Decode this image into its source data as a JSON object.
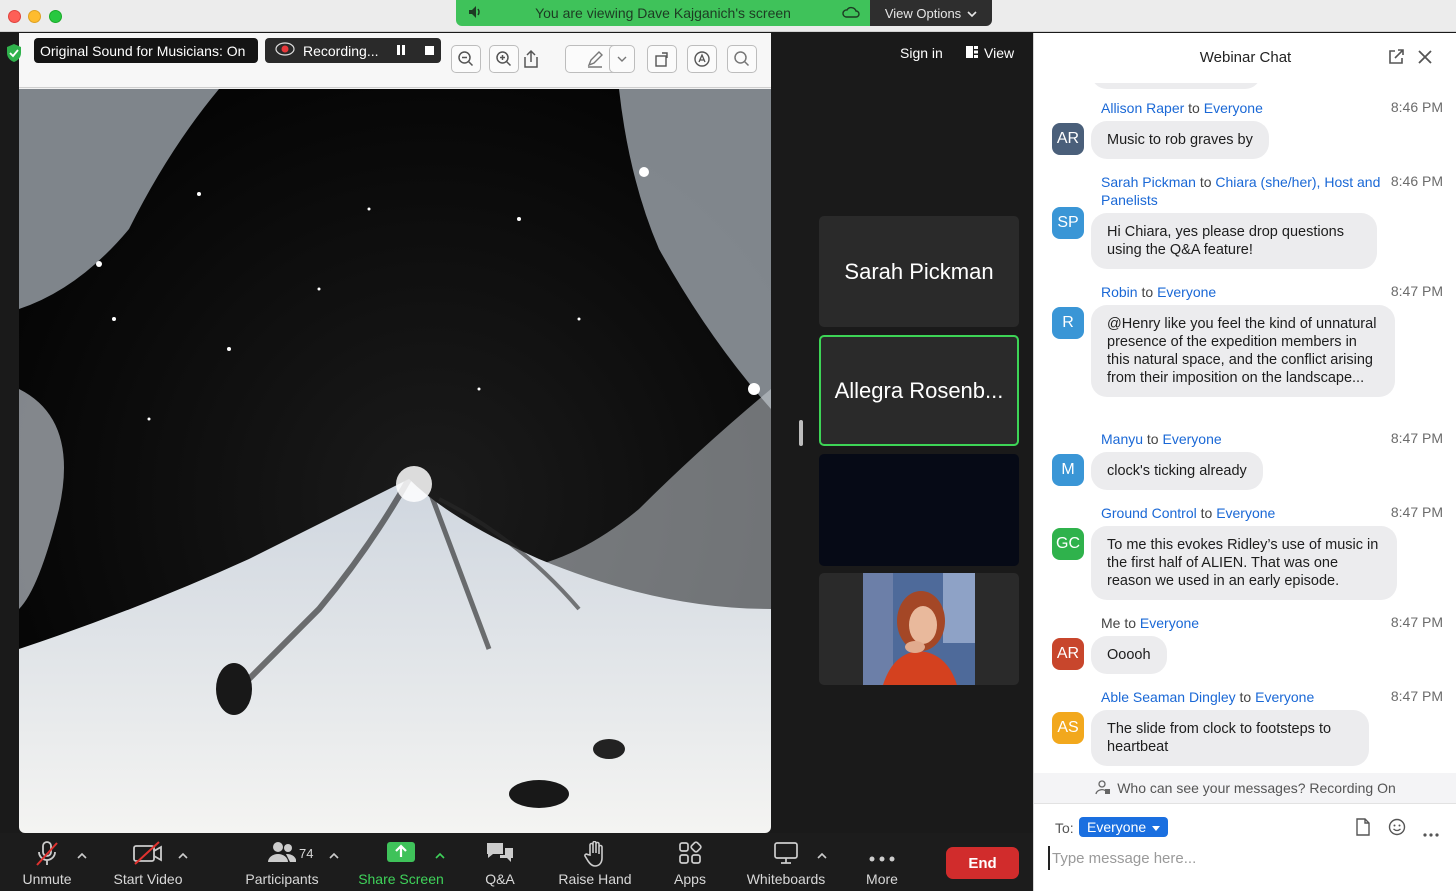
{
  "banner": {
    "text": "You are viewing Dave Kajganich's screen",
    "view_options": "View Options"
  },
  "overlay": {
    "sound": "Original Sound for Musicians: On",
    "recording": "Recording..."
  },
  "topright": {
    "sign_in": "Sign in",
    "view": "View"
  },
  "tiles": [
    {
      "name": "Sarah Pickman"
    },
    {
      "name": "Allegra Rosenb..."
    }
  ],
  "toolbar": {
    "unmute": "Unmute",
    "start_video": "Start Video",
    "participants": "Participants",
    "participants_count": "74",
    "share_screen": "Share Screen",
    "qa": "Q&A",
    "raise_hand": "Raise Hand",
    "apps": "Apps",
    "whiteboards": "Whiteboards",
    "more": "More",
    "end": "End"
  },
  "chat": {
    "title": "Webinar Chat",
    "messages": [
      {
        "sender": "Allison Raper",
        "to_word": "to",
        "recipient": "Everyone",
        "time": "8:46 PM",
        "initials": "AR",
        "avatar_color": "#4a5f7a",
        "text": "Music to rob graves by"
      },
      {
        "sender": "Sarah Pickman",
        "to_word": "to",
        "recipient": "Chiara (she/her), Host and Panelists",
        "time": "8:46 PM",
        "initials": "SP",
        "avatar_color": "#3a96d6",
        "text": "Hi Chiara, yes please drop questions using the Q&A feature!"
      },
      {
        "sender": "Robin",
        "to_word": "to",
        "recipient": "Everyone",
        "time": "8:47 PM",
        "initials": "R",
        "avatar_color": "#3a96d6",
        "text": "@Henry like you feel the kind of unnatural presence of the expedition members in this natural space, and the conflict arising from their imposition on the landscape..."
      },
      {
        "sender": "Manyu",
        "to_word": "to",
        "recipient": "Everyone",
        "time": "8:47 PM",
        "initials": "M",
        "avatar_color": "#3a96d6",
        "text": "clock's ticking already"
      },
      {
        "sender": "Ground Control",
        "to_word": "to",
        "recipient": "Everyone",
        "time": "8:47 PM",
        "initials": "GC",
        "avatar_color": "#2fb24c",
        "text": "To me this evokes Ridley’s use of music in the first half of ALIEN. That was one reason we used in an early episode."
      },
      {
        "sender": "Me",
        "to_word": "to",
        "recipient": "Everyone",
        "time": "8:47 PM",
        "initials": "AR",
        "avatar_color": "#c8462c",
        "text": "Ooooh"
      },
      {
        "sender": "Able Seaman Dingley",
        "to_word": "to",
        "recipient": "Everyone",
        "time": "8:47 PM",
        "initials": "AS",
        "avatar_color": "#f2a81d",
        "text": "The slide from clock to footsteps to heartbeat"
      }
    ],
    "visibility_note": "Who can see your messages? Recording On",
    "to_label": "To:",
    "to_value": "Everyone",
    "input_placeholder": "Type message here..."
  }
}
